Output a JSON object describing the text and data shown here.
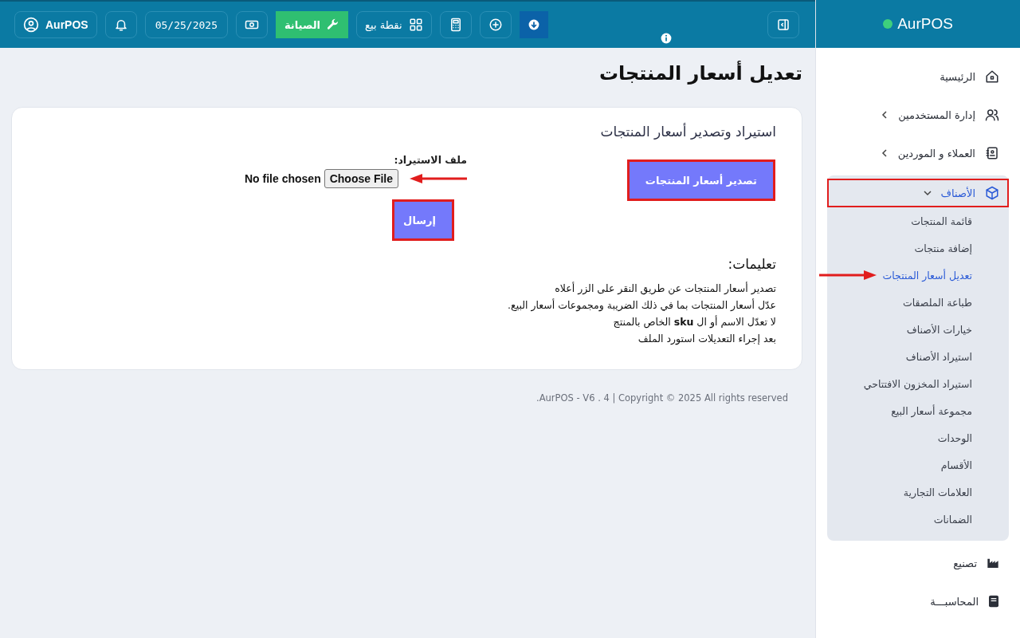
{
  "brand": {
    "name": "AurPOS"
  },
  "topbar": {
    "buttons": [
      {
        "kind": "download"
      },
      {
        "kind": "plus"
      },
      {
        "kind": "calculator"
      },
      {
        "kind": "pos",
        "label": "نقطة بيع"
      },
      {
        "kind": "maintenance",
        "label": "الصيانة"
      },
      {
        "kind": "cash"
      },
      {
        "kind": "date",
        "label": "05/25/2025"
      },
      {
        "kind": "bell"
      },
      {
        "kind": "user",
        "label": "AurPOS"
      }
    ]
  },
  "sidebar": {
    "items": [
      {
        "label": "الرئيسية",
        "kind": "home",
        "has_submenu": false,
        "expanded": false,
        "highlighted": false
      },
      {
        "label": "إدارة المستخدمين",
        "kind": "users",
        "has_submenu": true,
        "expanded": false,
        "highlighted": false
      },
      {
        "label": "العملاء و الموردين",
        "kind": "contacts",
        "has_submenu": true,
        "expanded": false,
        "highlighted": false
      },
      {
        "label": "الأصناف",
        "kind": "box",
        "has_submenu": true,
        "expanded": true,
        "highlighted": true,
        "children": [
          {
            "label": "قائمة المنتجات",
            "selected": false,
            "arrow": false
          },
          {
            "label": "إضافة منتجات",
            "selected": false,
            "arrow": false
          },
          {
            "label": "تعديل أسعار المنتجات",
            "selected": true,
            "arrow": true
          },
          {
            "label": "طباعة الملصقات",
            "selected": false,
            "arrow": false
          },
          {
            "label": "خيارات الأصناف",
            "selected": false,
            "arrow": false
          },
          {
            "label": "استيراد الأصناف",
            "selected": false,
            "arrow": false
          },
          {
            "label": "استيراد المخزون الافتتاحي",
            "selected": false,
            "arrow": false
          },
          {
            "label": "مجموعة أسعار البيع",
            "selected": false,
            "arrow": false
          },
          {
            "label": "الوحدات",
            "selected": false,
            "arrow": false
          },
          {
            "label": "الأقسام",
            "selected": false,
            "arrow": false
          },
          {
            "label": "العلامات التجارية",
            "selected": false,
            "arrow": false
          },
          {
            "label": "الضمانات",
            "selected": false,
            "arrow": false
          }
        ]
      },
      {
        "label": "تصنيع",
        "kind": "factory",
        "has_submenu": false,
        "expanded": false,
        "highlighted": false
      },
      {
        "label": "المحاسبـــة",
        "kind": "book",
        "has_submenu": false,
        "expanded": false,
        "highlighted": false
      }
    ]
  },
  "page": {
    "title": "تعديل أسعار المنتجات"
  },
  "card": {
    "title": "استيراد وتصدير أسعار المنتجات",
    "export_button": {
      "label": "تصدير أسعار المنتجات",
      "highlighted": true
    },
    "import": {
      "label": "ملف الاستيراد:",
      "choose_button": "Choose File",
      "file_status": "No file chosen",
      "arrow": true
    },
    "submit_button": {
      "label": "إرسال",
      "highlighted": true
    },
    "instructions_title": "تعليمات:",
    "instructions": [
      "تصدير أسعار المنتجات عن طريق النقر على الزر أعلاه",
      "عدّل أسعار المنتجات بما في ذلك الضريبة ومجموعات أسعار البيع.",
      "لا تعدّل الاسم أو ال **sku** الخاص بالمنتج",
      "بعد إجراء التعديلات استورد الملف"
    ]
  },
  "footer": "AurPOS - V6 . 4 | Copyright © 2025 All rights reserved."
}
